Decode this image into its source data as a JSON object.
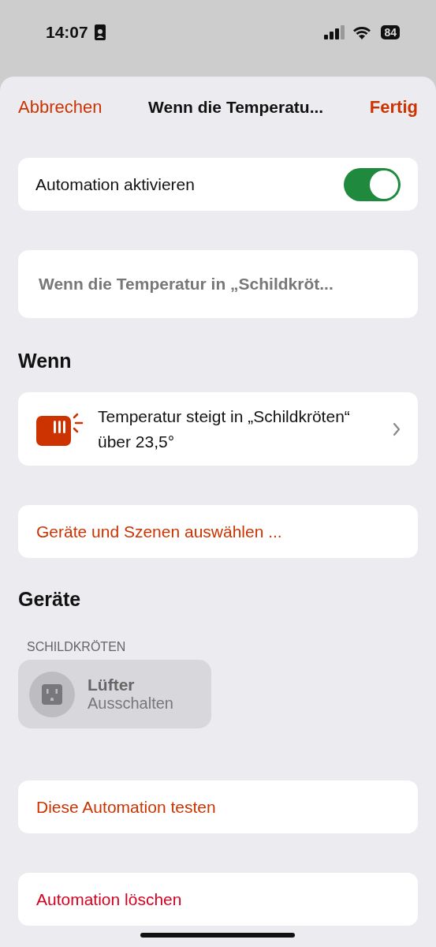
{
  "status_bar": {
    "time": "14:07",
    "battery": "84"
  },
  "nav": {
    "cancel": "Abbrechen",
    "title": "Wenn die Temperatu...",
    "done": "Fertig"
  },
  "activate": {
    "label": "Automation aktivieren",
    "on": true
  },
  "name_field": {
    "value": "Wenn die Temperatur in „Schildkröt..."
  },
  "when": {
    "heading": "Wenn",
    "trigger": "Temperatur steigt in „Schildkröten“ über 23,5°"
  },
  "select_action": "Geräte und Szenen auswählen ...",
  "devices": {
    "heading": "Geräte",
    "room": "SCHILDKRÖTEN",
    "items": [
      {
        "name": "Lüfter",
        "action": "Ausschalten"
      }
    ]
  },
  "actions": [
    {
      "label": "Diese Automation testen",
      "kind": "normal"
    },
    {
      "label": "Automation löschen",
      "kind": "destructive"
    }
  ]
}
